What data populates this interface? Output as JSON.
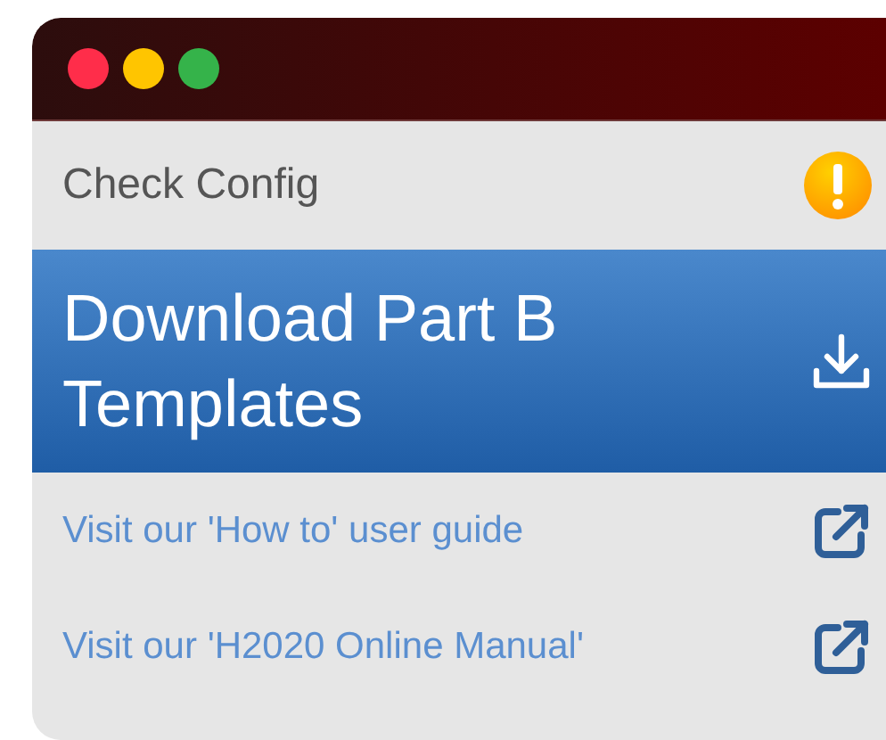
{
  "items": [
    {
      "kind": "warning",
      "label": "Check Config",
      "selected": false
    },
    {
      "kind": "download",
      "label": "Download Part B Templates",
      "selected": true
    },
    {
      "kind": "link",
      "label": "Visit our 'How to' user guide",
      "selected": false
    },
    {
      "kind": "link",
      "label": "Visit our 'H2020 Online Manual'",
      "selected": false
    }
  ]
}
